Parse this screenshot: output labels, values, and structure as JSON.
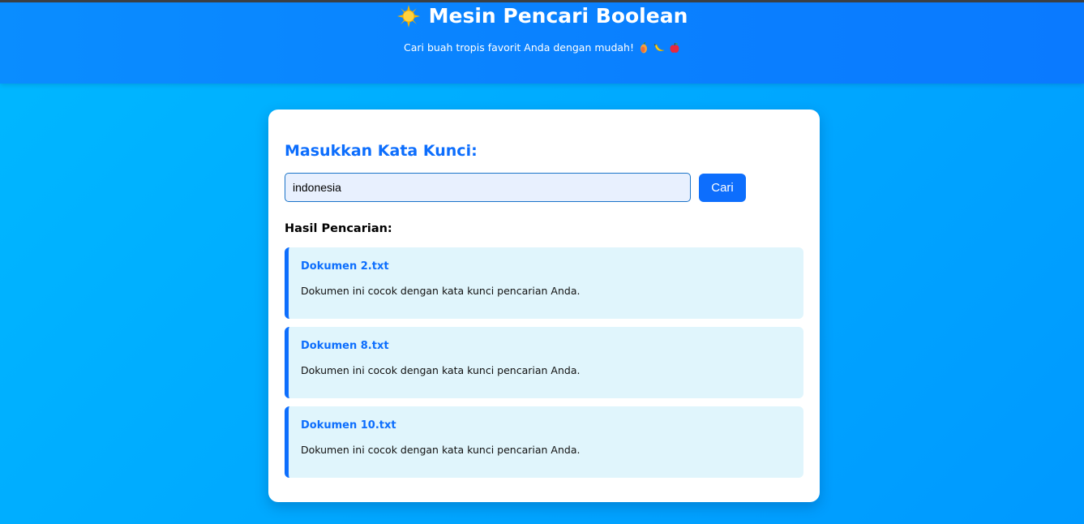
{
  "header": {
    "title": "Mesin Pencari Boolean",
    "title_icon": "glowing-sun-icon",
    "subtitle": "Cari buah tropis favorit Anda dengan mudah!",
    "subtitle_icons": [
      "mango-icon",
      "banana-icon",
      "apple-icon"
    ]
  },
  "search": {
    "heading": "Masukkan Kata Kunci:",
    "value": "indonesia",
    "placeholder": "",
    "button_label": "Cari"
  },
  "results": {
    "heading": "Hasil Pencarian:",
    "items": [
      {
        "title": "Dokumen 2.txt",
        "description": "Dokumen ini cocok dengan kata kunci pencarian Anda."
      },
      {
        "title": "Dokumen 8.txt",
        "description": "Dokumen ini cocok dengan kata kunci pencarian Anda."
      },
      {
        "title": "Dokumen 10.txt",
        "description": "Dokumen ini cocok dengan kata kunci pencarian Anda."
      }
    ]
  },
  "colors": {
    "header_bg": "#0a80ff",
    "page_bg": "#00aaff",
    "accent": "#0d6efd",
    "result_bg": "#e0f5fc"
  }
}
